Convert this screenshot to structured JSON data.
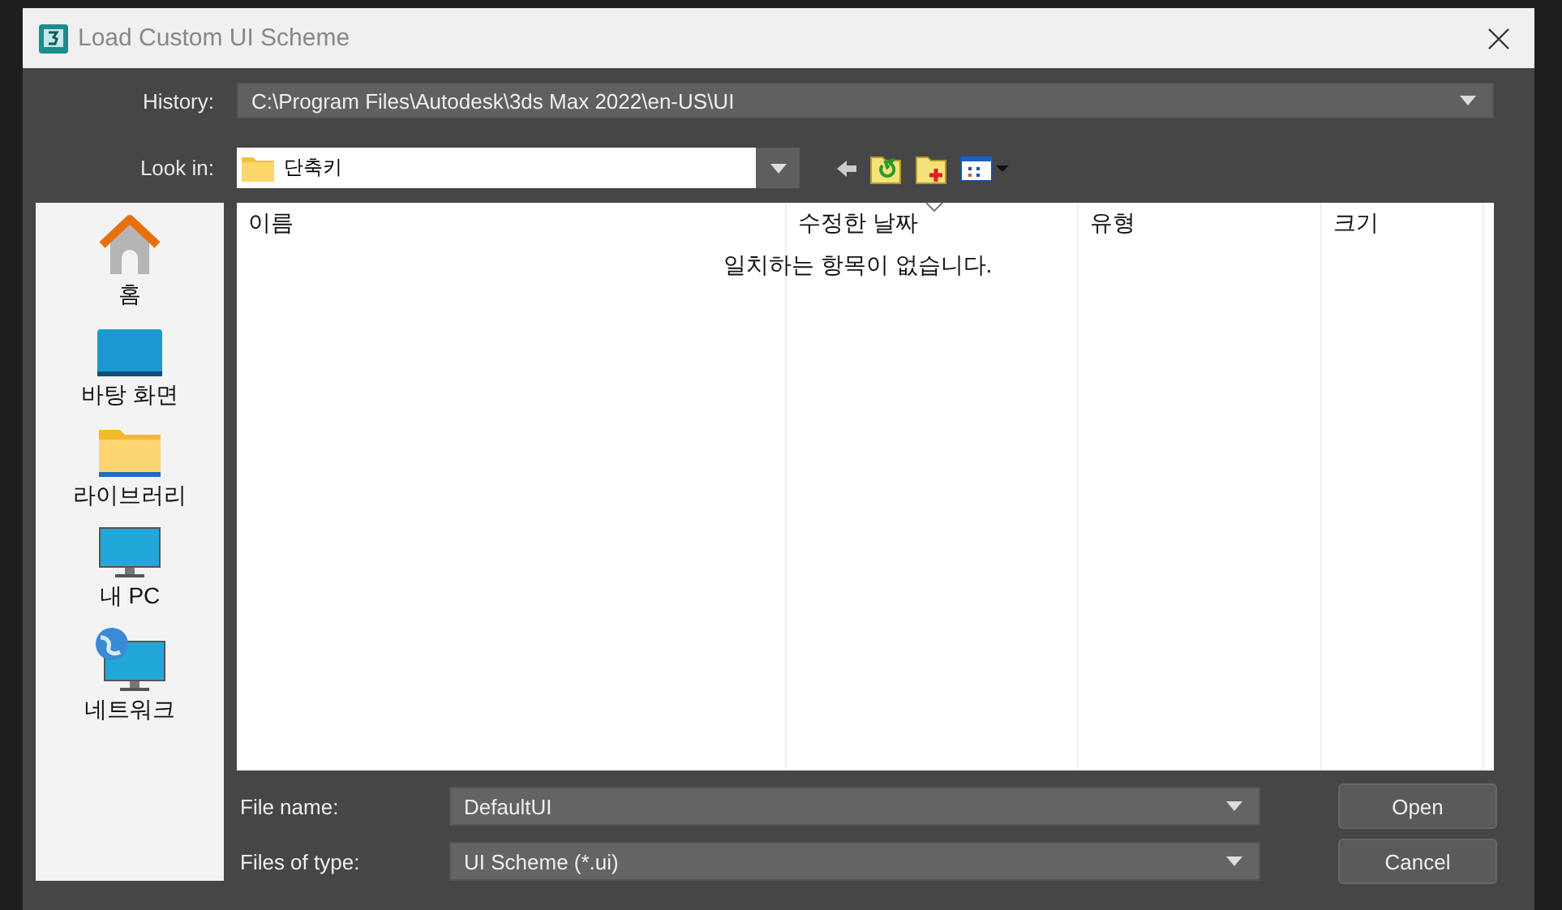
{
  "window": {
    "title": "Load Custom UI Scheme"
  },
  "history": {
    "label": "History:",
    "value": "C:\\Program Files\\Autodesk\\3ds Max 2022\\en-US\\UI"
  },
  "look_in": {
    "label": "Look in:",
    "value": "단축키"
  },
  "sidebar": {
    "items": [
      {
        "label": "홈",
        "kind": "home"
      },
      {
        "label": "바탕 화면",
        "kind": "desktop"
      },
      {
        "label": "라이브러리",
        "kind": "library"
      },
      {
        "label": "내 PC",
        "kind": "pc"
      },
      {
        "label": "네트워크",
        "kind": "network"
      }
    ]
  },
  "table": {
    "columns": [
      "이름",
      "수정한 날짜",
      "유형",
      "크기"
    ],
    "empty_message": "일치하는 항목이 없습니다."
  },
  "file_name": {
    "label": "File name:",
    "value": "DefaultUI"
  },
  "file_type": {
    "label": "Files of type:",
    "value": "UI Scheme (*.ui)"
  },
  "buttons": [
    "Open",
    "Cancel"
  ]
}
